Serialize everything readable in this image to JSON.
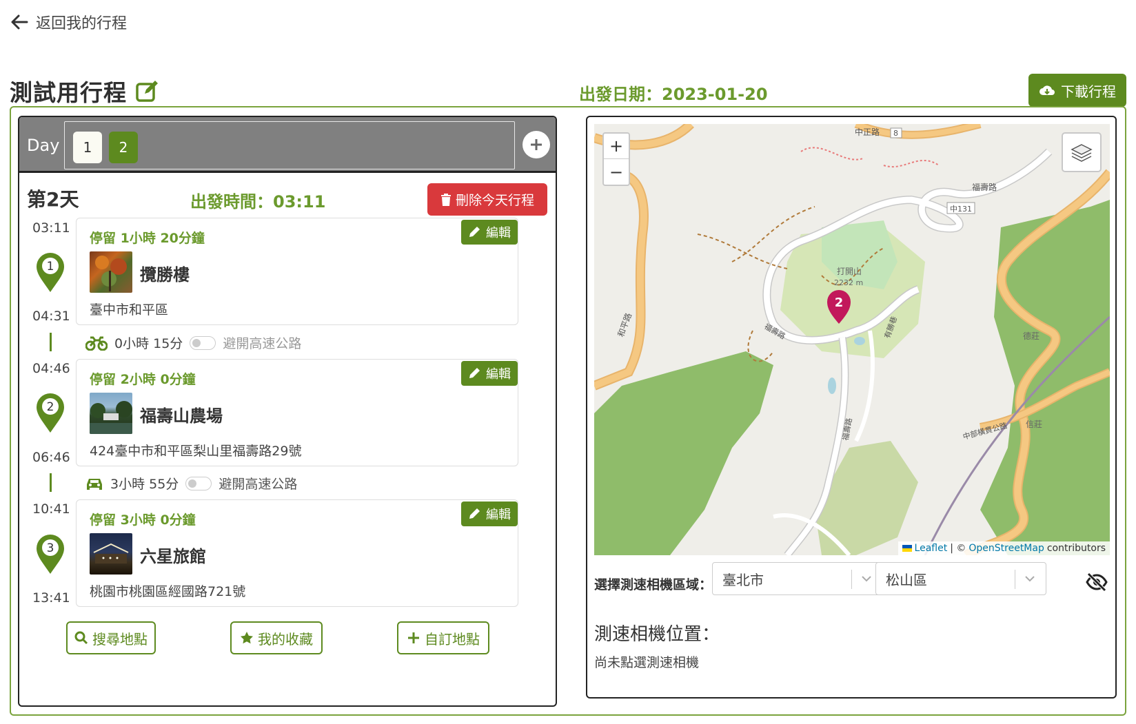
{
  "nav": {
    "back_label": "返回我的行程"
  },
  "header": {
    "trip_title": "測試用行程",
    "depart_date_label": "出發日期：",
    "depart_date": "2023-01-20",
    "download_label": "下載行程"
  },
  "days": {
    "label": "Day",
    "chips": [
      "1",
      "2"
    ],
    "active_day": "2"
  },
  "day_detail": {
    "title": "第2天",
    "depart_time_label": "出發時間：",
    "depart_time": "03:11",
    "delete_label": "刪除今天行程"
  },
  "stops": [
    {
      "number": "1",
      "arrive": "03:11",
      "leave": "04:31",
      "stay": "停留 1小時 20分鐘",
      "name": "攬勝樓",
      "address": "臺中市和平區",
      "edit_label": "編輯"
    },
    {
      "number": "2",
      "arrive": "04:46",
      "leave": "06:46",
      "stay": "停留 2小時 0分鐘",
      "name": "福壽山農場",
      "address": "424臺中市和平區梨山里福壽路29號",
      "edit_label": "編輯"
    },
    {
      "number": "3",
      "arrive": "10:41",
      "leave": "13:41",
      "stay": "停留 3小時 0分鐘",
      "name": "六星旅館",
      "address": "桃園市桃園區經國路721號",
      "edit_label": "編輯"
    }
  ],
  "travels": [
    {
      "mode": "motorcycle-icon",
      "duration": "0小時 15分",
      "avoid_label": "避開高速公路",
      "avoid_on": false
    },
    {
      "mode": "car-icon",
      "duration": "3小時 55分",
      "avoid_label": "避開高速公路",
      "avoid_on": false
    }
  ],
  "actions": {
    "search_label": "搜尋地點",
    "favorites_label": "我的收藏",
    "custom_label": "自訂地點"
  },
  "map": {
    "zoom_in": "+",
    "zoom_out": "−",
    "attribution_leaflet": "Leaflet",
    "attribution_sep": "| ©",
    "attribution_osm": "OpenStreetMap",
    "attribution_tail": "contributors",
    "marker_label": "2",
    "labels": {
      "road_zhongzheng": "中正路",
      "route_8": "8",
      "road_fushou_n": "福壽路",
      "road_zhong131": "中131",
      "peak_name": "打開山",
      "peak_elev": "2232 m",
      "road_heping": "和平路",
      "road_fushou_w": "福壽路",
      "road_youshoushe": "有勝巷",
      "road_fushou_s": "福壽路",
      "village_dezhuang": "德莊",
      "village_xinzhuang": "信莊",
      "road_cross_highway": "中部橫貫公路"
    }
  },
  "camera": {
    "region_label": "選擇測速相機區域：",
    "city": "臺北市",
    "district": "松山區",
    "position_title": "測速相機位置：",
    "position_value": "尚未點選測速相機"
  },
  "colors": {
    "primary": "#5d8a1f",
    "accent_text": "#6b9a2d",
    "danger": "#d9393c",
    "day_bar": "#808080"
  }
}
